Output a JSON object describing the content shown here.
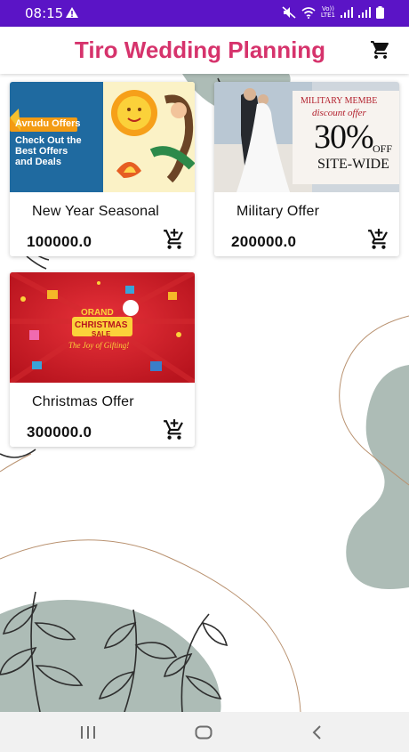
{
  "status_bar": {
    "time": "08:15",
    "volte_line1": "Vo))",
    "volte_line2": "LTE1",
    "icons": [
      "warning-icon",
      "mute-icon",
      "wifi-icon",
      "signal-icon",
      "signal-icon",
      "battery-icon"
    ]
  },
  "app_bar": {
    "title": "Tiro Wedding Planning",
    "cart_icon": "cart-icon"
  },
  "colors": {
    "status_bar": "#5b14c6",
    "title": "#d6336c",
    "sage": "#adbcb6"
  },
  "offers": [
    {
      "name": "New Year Seasonal",
      "price": "100000.0",
      "image": {
        "badge": "Avrudu Offers",
        "line1": "Check Out the",
        "line2": "Best Offers",
        "line3": "and Deals"
      }
    },
    {
      "name": "Military Offer",
      "price": "200000.0",
      "image": {
        "line1": "MILITARY MEMBE",
        "line2": "discount offer",
        "big": "30%",
        "off": "OFF",
        "sitewide": "SITE-WIDE"
      }
    },
    {
      "name": "Christmas Offer",
      "price": "300000.0",
      "image": {
        "top": "ORAND",
        "middle": "CHRISTMAS",
        "bottom": "SALE",
        "tagline": "The Joy of Gifting!"
      }
    }
  ],
  "nav_bar": {
    "icons": [
      "recent-apps-icon",
      "home-icon",
      "back-icon"
    ]
  }
}
